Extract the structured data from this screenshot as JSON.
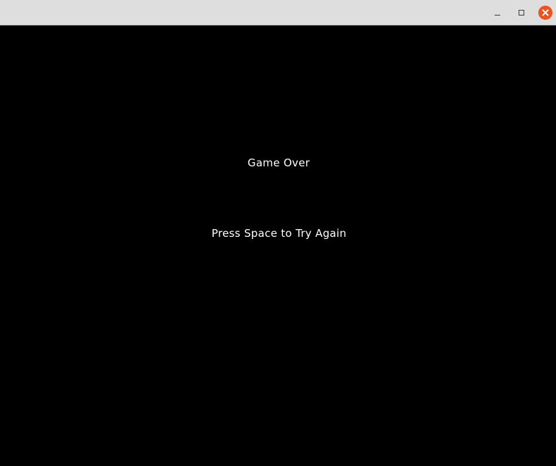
{
  "window": {
    "title": "",
    "controls": {
      "minimize_icon": "minimize-icon",
      "maximize_icon": "maximize-icon",
      "close_icon": "close-icon",
      "close_color": "#e95420"
    }
  },
  "game": {
    "background_color": "#000000",
    "text_color": "#ffffff",
    "title": "Game Over",
    "prompt": "Press Space to Try Again"
  }
}
